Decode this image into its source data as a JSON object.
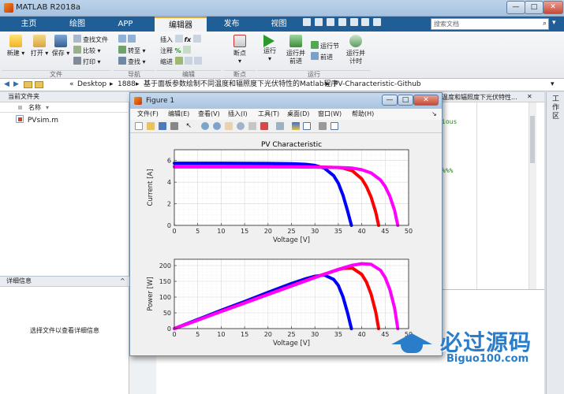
{
  "window": {
    "title": "MATLAB R2018a",
    "min": "—",
    "max": "□",
    "close": "✕"
  },
  "tabs": [
    {
      "label": "主页"
    },
    {
      "label": "绘图"
    },
    {
      "label": "APP"
    },
    {
      "label": "编辑器"
    },
    {
      "label": "发布"
    },
    {
      "label": "视图"
    }
  ],
  "search": {
    "placeholder": "搜索文档"
  },
  "ribbon": {
    "file": {
      "new": "新建",
      "open": "打开",
      "save": "保存",
      "find_files": "查找文件",
      "compare": "比较",
      "print": "打印",
      "section": "文件"
    },
    "nav": {
      "goto": "转至",
      "find": "查找",
      "section": "导航"
    },
    "edit": {
      "insert": "插入",
      "comment": "注释",
      "indent": "缩进",
      "section": "编辑"
    },
    "breakpoints": {
      "label": "断点",
      "section": "断点"
    },
    "run": {
      "run": "运行",
      "run_advance": "运行并\n前进",
      "run_section": "运行节",
      "advance": "前进",
      "run_time": "运行并\n计时",
      "section": "运行"
    }
  },
  "address": {
    "sep": "«",
    "crumbs": [
      "Desktop",
      "1888",
      "基于面板参数绘制不同温度和辐照度下光伏特性的Matlab程序",
      "PV-Characteristic-Github"
    ]
  },
  "current_folder": {
    "title": "当前文件夹",
    "col_name": "名称",
    "files": [
      "PVsim.m"
    ]
  },
  "details": {
    "title": "详细信息",
    "hint": "选择文件以查看详细信息"
  },
  "editor": {
    "tab_title": "温度和辐照度下光伏特性...",
    "code_fragment_1": "ious",
    "code_fragment_2": "%%%",
    "workspace_label": "工作区"
  },
  "figure": {
    "title": "Figure 1",
    "menu": [
      "文件(F)",
      "编辑(E)",
      "查看(V)",
      "插入(I)",
      "工具(T)",
      "桌面(D)",
      "窗口(W)",
      "帮助(H)"
    ]
  },
  "chart_data": [
    {
      "type": "line",
      "title": "PV Characteristic",
      "xlabel": "Voltage [V]",
      "ylabel": "Current [A]",
      "xlim": [
        0,
        50
      ],
      "ylim": [
        0,
        7
      ],
      "xticks": [
        0,
        5,
        10,
        15,
        20,
        25,
        30,
        35,
        40,
        45,
        50
      ],
      "yticks": [
        0,
        2,
        4,
        6
      ],
      "grid": true,
      "series": [
        {
          "color": "#0000ff",
          "x": [
            0,
            5,
            10,
            15,
            20,
            25,
            28,
            30,
            32,
            34,
            35,
            36,
            37,
            37.8
          ],
          "y": [
            5.75,
            5.75,
            5.75,
            5.74,
            5.73,
            5.7,
            5.65,
            5.55,
            5.3,
            4.6,
            3.9,
            2.8,
            1.3,
            0
          ]
        },
        {
          "color": "#ff0000",
          "x": [
            0,
            5,
            10,
            15,
            20,
            25,
            30,
            35,
            36,
            38,
            40,
            41,
            42,
            43,
            43.6
          ],
          "y": [
            5.45,
            5.45,
            5.45,
            5.45,
            5.45,
            5.44,
            5.42,
            5.35,
            5.3,
            5.05,
            4.3,
            3.6,
            2.6,
            1.2,
            0
          ]
        },
        {
          "color": "#ff00ff",
          "x": [
            0,
            5,
            10,
            15,
            20,
            25,
            30,
            35,
            38,
            40,
            42,
            44,
            45,
            46,
            47,
            47.7
          ],
          "y": [
            5.4,
            5.4,
            5.4,
            5.4,
            5.4,
            5.4,
            5.39,
            5.36,
            5.3,
            5.15,
            4.85,
            4.2,
            3.6,
            2.7,
            1.4,
            0
          ]
        }
      ]
    },
    {
      "type": "line",
      "title": "",
      "xlabel": "Voltage [V]",
      "ylabel": "Power [W]",
      "xlim": [
        0,
        50
      ],
      "ylim": [
        0,
        220
      ],
      "xticks": [
        0,
        5,
        10,
        15,
        20,
        25,
        30,
        35,
        40,
        45,
        50
      ],
      "yticks": [
        0,
        50,
        100,
        150,
        200
      ],
      "grid": true,
      "series": [
        {
          "color": "#0000ff",
          "x": [
            0,
            5,
            10,
            15,
            20,
            25,
            28,
            30,
            32,
            34,
            35,
            36,
            37,
            37.8
          ],
          "y": [
            0,
            29,
            58,
            86,
            115,
            143,
            158,
            166,
            170,
            156,
            137,
            101,
            48,
            0
          ]
        },
        {
          "color": "#ff0000",
          "x": [
            0,
            5,
            10,
            15,
            20,
            25,
            30,
            35,
            36,
            38,
            40,
            41,
            42,
            43,
            43.6
          ],
          "y": [
            0,
            27,
            55,
            82,
            109,
            136,
            163,
            187,
            191,
            192,
            172,
            148,
            109,
            52,
            0
          ]
        },
        {
          "color": "#ff00ff",
          "x": [
            0,
            5,
            10,
            15,
            20,
            25,
            30,
            35,
            38,
            40,
            42,
            44,
            45,
            46,
            47,
            47.7
          ],
          "y": [
            0,
            27,
            54,
            81,
            108,
            135,
            162,
            188,
            201,
            206,
            204,
            185,
            162,
            124,
            66,
            0
          ]
        }
      ]
    }
  ],
  "watermark": {
    "text": "必过源码",
    "url": "Biguo100.com"
  }
}
